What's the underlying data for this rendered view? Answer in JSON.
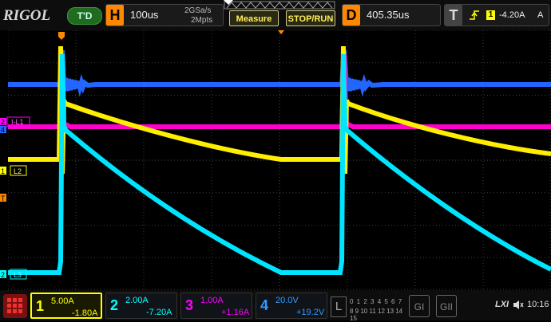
{
  "header": {
    "brand": "RIGOL",
    "run_state": "T'D",
    "horizontal": {
      "letter": "H",
      "timebase": "100us",
      "sample_rate": "2GSa/s",
      "memory_depth": "2Mpts"
    },
    "measure_label": "Measure",
    "stoprun_label": "STOP/RUN",
    "delay": {
      "letter": "D",
      "value": "405.35us"
    },
    "trigger": {
      "letter": "T",
      "source": "1",
      "level": "-4.20A",
      "unit": "A"
    }
  },
  "waveform": {
    "labels": {
      "i_l1": "I-L1",
      "l2": "L2",
      "l3": "L3"
    },
    "markers": {
      "ch2_num": "2",
      "ch1_num": "1",
      "ch3_num": "2",
      "ch4_num": "4",
      "trigger_marker": "T"
    }
  },
  "channels": [
    {
      "num": "1",
      "scale": "5.00A",
      "offset": "-1.80A",
      "color": "#ffff00"
    },
    {
      "num": "2",
      "scale": "2.00A",
      "offset": "-7.20A",
      "color": "#00ffff"
    },
    {
      "num": "3",
      "scale": "1.00A",
      "offset": "+1.16A",
      "color": "#ff00ff"
    },
    {
      "num": "4",
      "scale": "20.0V",
      "offset": "+19.2V",
      "color": "#3399ff"
    }
  ],
  "digital": {
    "letter": "L",
    "row1": "0 1 2 3 4 5 6 7",
    "row2": "8 9 10 11 12 13 14 15"
  },
  "buttons": {
    "g1": "GI",
    "g2": "GII"
  },
  "status": {
    "lxi": "LXI",
    "time": "10:16"
  },
  "colors": {
    "ch1": "#ffff00",
    "ch2": "#00ffff",
    "ch3": "#ff00ff",
    "ch4": "#2277ff",
    "accent": "#ff8800"
  }
}
